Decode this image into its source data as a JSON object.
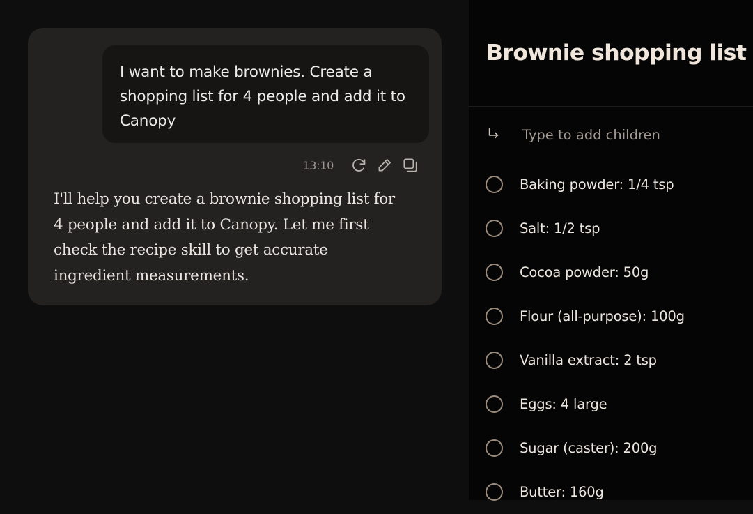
{
  "chat": {
    "user_message": "I want to make brownies. Create a shopping list for 4 people and add it to Canopy",
    "timestamp": "13:10",
    "actions": [
      {
        "name": "retry-icon"
      },
      {
        "name": "edit-icon"
      },
      {
        "name": "copy-icon"
      }
    ],
    "assistant_message": "I'll help you create a brownie shopping list for 4 people and add it to Canopy. Let me first check the recipe skill to get accurate ingredient measurements."
  },
  "list": {
    "title": "Brownie shopping list",
    "add_placeholder": "Type to add children",
    "add_icon": "return-arrow-icon",
    "items": [
      {
        "label": "Baking powder: 1/4 tsp",
        "checked": false
      },
      {
        "label": "Salt: 1/2 tsp",
        "checked": false
      },
      {
        "label": "Cocoa powder: 50g",
        "checked": false
      },
      {
        "label": "Flour (all-purpose): 100g",
        "checked": false
      },
      {
        "label": "Vanilla extract: 2 tsp",
        "checked": false
      },
      {
        "label": "Eggs: 4 large",
        "checked": false
      },
      {
        "label": "Sugar (caster): 200g",
        "checked": false
      },
      {
        "label": "Butter: 160g",
        "checked": false
      }
    ]
  },
  "colors": {
    "background": "#0f0e0e",
    "card": "#232221",
    "user_bubble": "#161514",
    "list_panel": "#050505",
    "title": "#f0e6dc",
    "checkbox_border": "#9a8b7d",
    "placeholder": "#a49b92"
  }
}
